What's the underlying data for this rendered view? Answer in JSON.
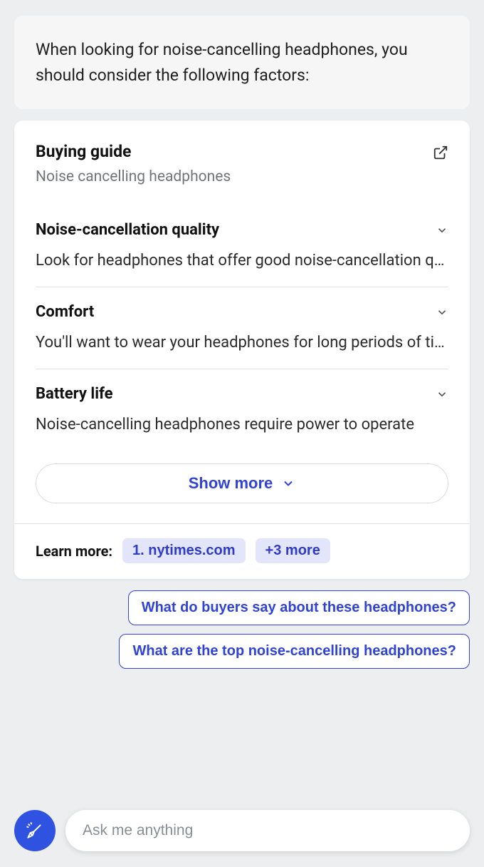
{
  "message": "When looking for noise-cancelling headphones, you should consider the following factors:",
  "card": {
    "title": "Buying guide",
    "subtitle": "Noise cancelling headphones",
    "sections": [
      {
        "title": "Noise-cancellation quality",
        "body": "Look for headphones that offer good noise-cancellation quality"
      },
      {
        "title": "Comfort",
        "body": "You'll want to wear your headphones for long periods of time"
      },
      {
        "title": "Battery life",
        "body": "Noise-cancelling headphones require power to operate"
      }
    ],
    "show_more": "Show more"
  },
  "learn_more": {
    "label": "Learn more:",
    "source": "1. nytimes.com",
    "more": "+3 more"
  },
  "suggestions": [
    "What do buyers say about these headphones?",
    "What are the top noise-cancelling headphones?"
  ],
  "composer": {
    "placeholder": "Ask me anything"
  }
}
